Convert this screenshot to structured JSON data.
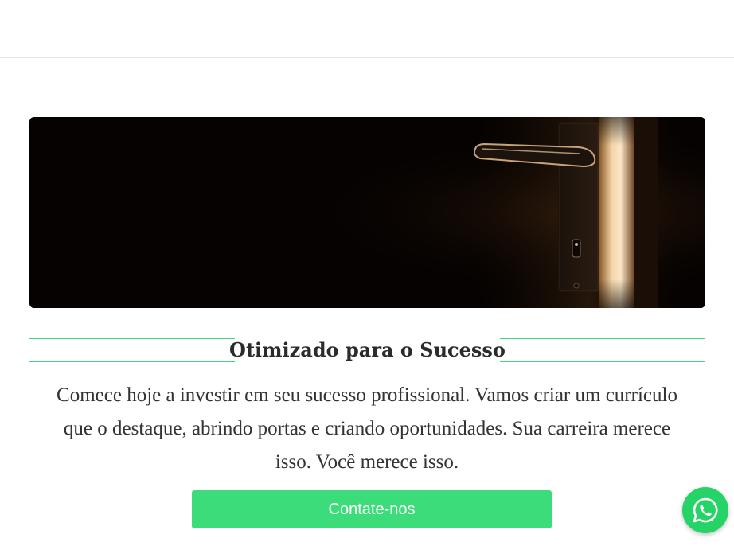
{
  "colors": {
    "accent": "#3ddc7a",
    "whatsapp": "#25d366",
    "text": "#333333"
  },
  "hero": {
    "image_description_icon": "door-handle-image"
  },
  "section": {
    "heading": "Otimizado para o Sucesso",
    "paragraph": "Comece hoje a investir em seu sucesso profissional. Vamos criar um currículo que o destaque, abrindo portas e criando oportunidades. Sua carreira merece isso. Você merece isso."
  },
  "cta": {
    "label": "Contate-nos"
  },
  "floating": {
    "icon": "whatsapp-icon"
  }
}
